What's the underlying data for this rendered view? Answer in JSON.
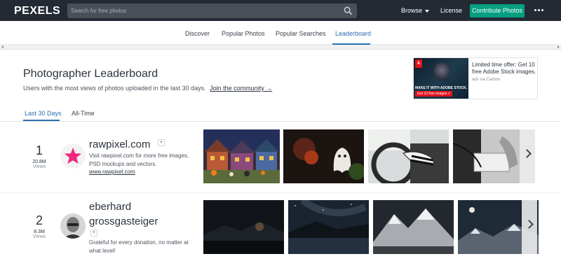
{
  "topbar": {
    "logo": "PEXELS",
    "search_placeholder": "Search for free photos",
    "browse_label": "Browse",
    "license_label": "License",
    "contribute_label": "Contribute Photos"
  },
  "subnav": {
    "items": [
      "Discover",
      "Popular Photos",
      "Popular Searches",
      "Leaderboard"
    ],
    "active": "Leaderboard"
  },
  "header": {
    "title": "Photographer Leaderboard",
    "subtitle": "Users with the most views of photos uploaded in the last 30 days.",
    "join_link": "Join the community →"
  },
  "ad": {
    "text": "Limited time offer: Get 10 free Adobe Stock images.",
    "via": "ads via Carbon",
    "brand_badge": "A",
    "image_tagline": "MAKE IT WITH ADOBE STOCK.",
    "image_cta": "Get 10 free images >"
  },
  "tabs": {
    "items": [
      "Last 30 Days",
      "All-Time"
    ],
    "active": "Last 30 Days"
  },
  "leaderboard": [
    {
      "rank": "1",
      "views": "20.8M",
      "views_label": "Views",
      "name": "rawpixel.com",
      "follow": "+",
      "description": "Visit rawpixel.com for more free images, PSD mockups and vectors.",
      "link": "www.rawpixel.com",
      "avatar_icon": "star-icon",
      "thumbnails": [
        "halloween-houses",
        "ghost-costume",
        "car-interior",
        "bw-hands"
      ]
    },
    {
      "rank": "2",
      "views": "8.3M",
      "views_label": "Views",
      "name_line1": "eberhard",
      "name_line2": "grossgasteiger",
      "follow": "+",
      "description": "Grateful for every donation, no matter at what level!",
      "avatar_icon": "portrait",
      "thumbnails": [
        "night-mountains",
        "starry-lake",
        "snowy-peaks",
        "moon-landscape"
      ]
    }
  ],
  "colors": {
    "topbar": "#232a34",
    "accent_green": "#05a081",
    "active_blue": "#2b6db0",
    "star_pink": "#f0297e"
  }
}
